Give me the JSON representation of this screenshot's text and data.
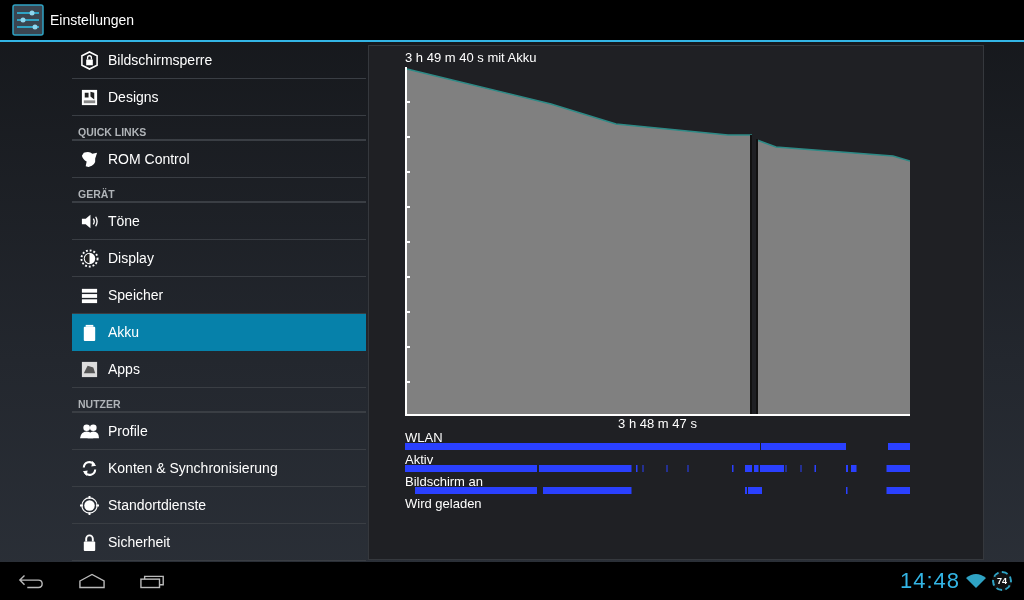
{
  "action_bar": {
    "title": "Einstellungen"
  },
  "sidebar": {
    "items": [
      {
        "kind": "item",
        "label": "Bildschirmsperre",
        "selected": false
      },
      {
        "kind": "item",
        "label": "Designs",
        "selected": false
      },
      {
        "kind": "header",
        "label": "QUICK LINKS"
      },
      {
        "kind": "item",
        "label": "ROM Control",
        "selected": false
      },
      {
        "kind": "header",
        "label": "GERÄT"
      },
      {
        "kind": "item",
        "label": "Töne",
        "selected": false
      },
      {
        "kind": "item",
        "label": "Display",
        "selected": false
      },
      {
        "kind": "item",
        "label": "Speicher",
        "selected": false
      },
      {
        "kind": "item",
        "label": "Akku",
        "selected": true
      },
      {
        "kind": "item",
        "label": "Apps",
        "selected": false
      },
      {
        "kind": "header",
        "label": "NUTZER"
      },
      {
        "kind": "item",
        "label": "Profile",
        "selected": false
      },
      {
        "kind": "item",
        "label": "Konten & Synchronisierung",
        "selected": false
      },
      {
        "kind": "item",
        "label": "Standortdienste",
        "selected": false
      },
      {
        "kind": "item",
        "label": "Sicherheit",
        "selected": false
      }
    ]
  },
  "battery_panel": {
    "title": "3 h 49 m 40 s mit Akku",
    "duration": "3 h 48 m 47 s",
    "timelines": [
      {
        "label": "WLAN"
      },
      {
        "label": "Aktiv"
      },
      {
        "label": "Bildschirm an"
      },
      {
        "label": "Wird geladen"
      }
    ]
  },
  "status_bar": {
    "time": "14:48",
    "battery": "74"
  }
}
